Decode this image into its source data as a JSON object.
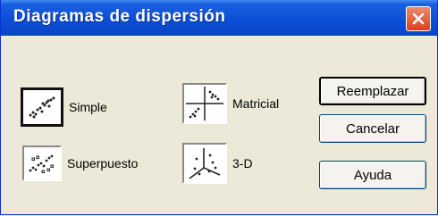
{
  "window": {
    "title": "Diagramas de dispersión"
  },
  "options": [
    {
      "label": "Simple",
      "icon": "simple-scatter-icon",
      "selected": true
    },
    {
      "label": "Superpuesto",
      "icon": "overlay-scatter-icon",
      "selected": false
    },
    {
      "label": "Matricial",
      "icon": "matrix-scatter-icon",
      "selected": false
    },
    {
      "label": "3-D",
      "icon": "3d-scatter-icon",
      "selected": false
    }
  ],
  "buttons": {
    "replace": "Reemplazar",
    "cancel": "Cancelar",
    "help": "Ayuda"
  }
}
